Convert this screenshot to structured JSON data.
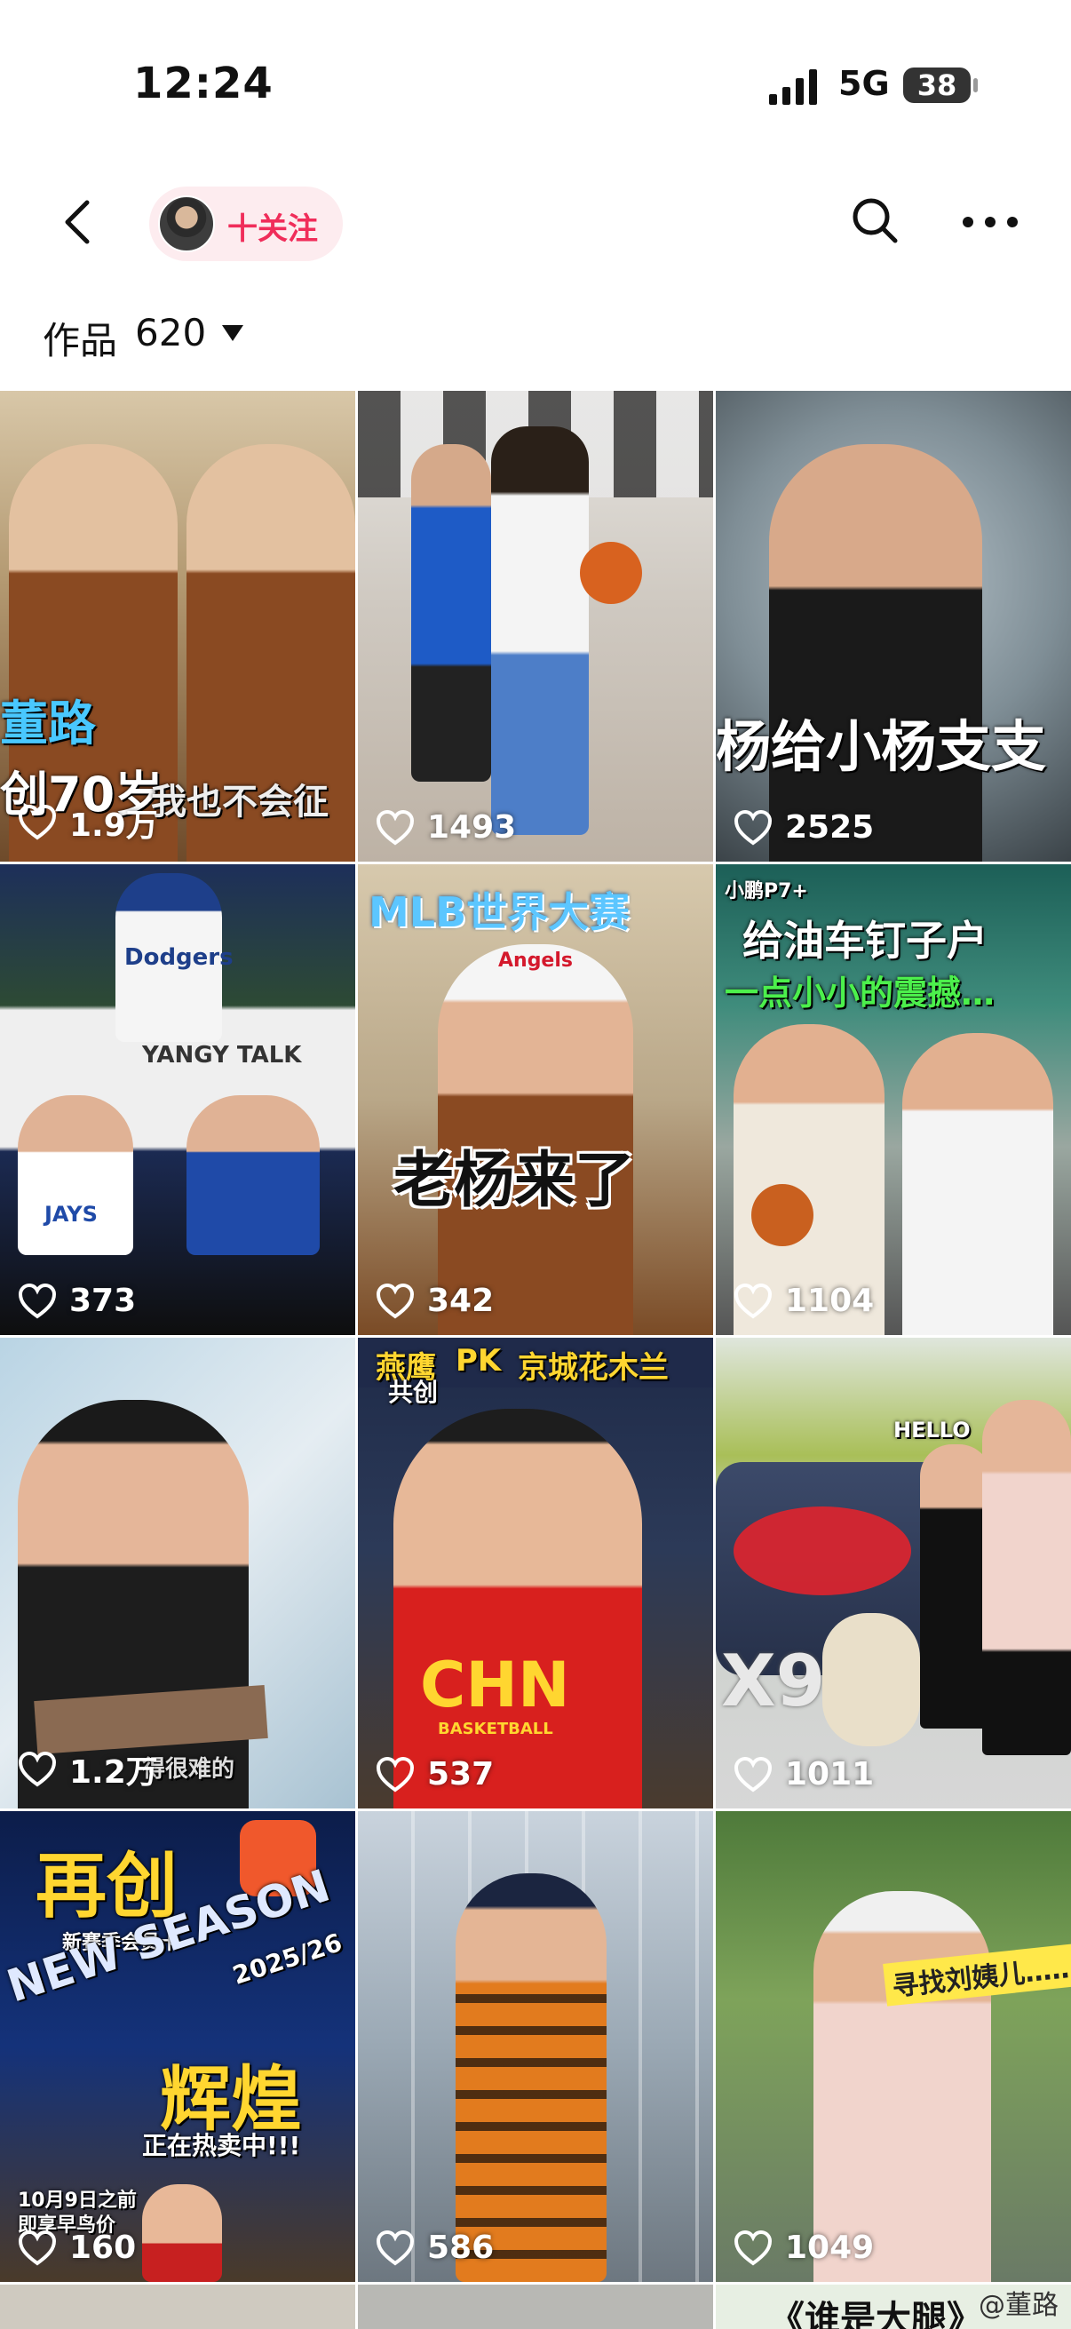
{
  "status": {
    "time": "12:24",
    "network": "5G",
    "battery": "38"
  },
  "header": {
    "follow_label": "十关注"
  },
  "works": {
    "label": "作品",
    "count": "620"
  },
  "videos": [
    {
      "likes": "1.9万",
      "captions": [
        "董路",
        "创70岁",
        "我也不会征"
      ]
    },
    {
      "likes": "1493",
      "captions": []
    },
    {
      "likes": "2525",
      "captions": [
        "杨给小杨支支"
      ]
    },
    {
      "likes": "373",
      "captions": [
        "Dodgers",
        "YANGY TALK",
        "JAYS"
      ]
    },
    {
      "likes": "342",
      "captions": [
        "MLB世界大赛",
        "老杨来了",
        "Angels"
      ]
    },
    {
      "likes": "1104",
      "captions": [
        "小鹏P7+",
        "给油车钉子户",
        "一点小小的震撼…"
      ]
    },
    {
      "likes": "1.2万",
      "captions": [
        "得很难的"
      ]
    },
    {
      "likes": "537",
      "captions": [
        "燕鹰",
        "PK",
        "京城花木兰",
        "共创",
        "CHN",
        "BASKETBALL"
      ]
    },
    {
      "likes": "1011",
      "captions": [
        "X9",
        "HELLO"
      ]
    },
    {
      "likes": "160",
      "captions": [
        "再创",
        "新赛季会员卡",
        "NEW SEASON",
        "2025/26",
        "辉煌",
        "正在热卖中!!!",
        "10月9日之前",
        "即享早鸟价"
      ]
    },
    {
      "likes": "586",
      "captions": []
    },
    {
      "likes": "1049",
      "captions": [
        "寻找刘姨儿……"
      ]
    },
    {
      "likes": "",
      "captions": [
        "《谁是大腿》"
      ]
    }
  ],
  "watermark": "@董路",
  "colors": {
    "accent": "#f02d5a",
    "pill_bg": "#fdecef"
  }
}
